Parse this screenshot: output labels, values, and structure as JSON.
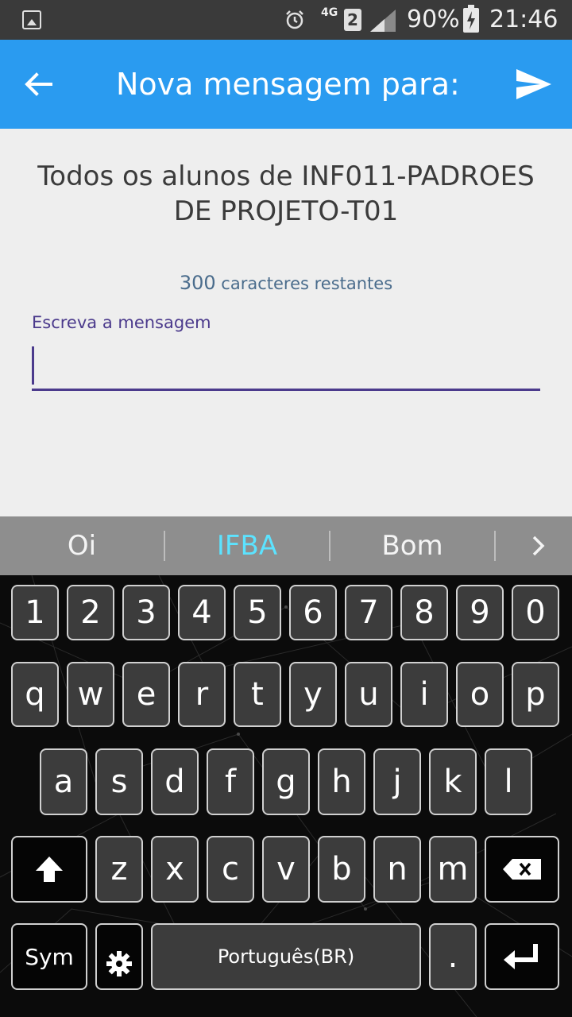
{
  "status_bar": {
    "battery_percent": "90%",
    "time": "21:46",
    "network_label": "4G",
    "sim_slot": "2",
    "icons": [
      "gallery-icon",
      "alarm-icon",
      "signal-icon",
      "battery-charging-icon"
    ]
  },
  "app_bar": {
    "title": "Nova mensagem para:",
    "back_icon": "arrow-left-icon",
    "send_icon": "send-icon",
    "color": "#2a9bf0"
  },
  "content": {
    "recipient": "Todos os alunos de INF011-PADROES DE PROJETO-T01",
    "chars_count": "300",
    "chars_suffix": " caracteres restantes",
    "message_label": "Escreva a mensagem",
    "message_value": ""
  },
  "suggestions": {
    "items": [
      "Oi",
      "IFBA",
      "Bom"
    ],
    "highlighted_index": 1,
    "more_icon": "chevron-right-icon"
  },
  "keyboard": {
    "row_numbers": [
      "1",
      "2",
      "3",
      "4",
      "5",
      "6",
      "7",
      "8",
      "9",
      "0"
    ],
    "row_top": [
      "q",
      "w",
      "e",
      "r",
      "t",
      "y",
      "u",
      "i",
      "o",
      "p"
    ],
    "row_home": [
      "a",
      "s",
      "d",
      "f",
      "g",
      "h",
      "j",
      "k",
      "l"
    ],
    "row_bottom": [
      "z",
      "x",
      "c",
      "v",
      "b",
      "n",
      "m"
    ],
    "sym_label": "Sym",
    "space_label": "Português(BR)",
    "period_label": ".",
    "shift_icon": "shift-icon",
    "backspace_icon": "backspace-icon",
    "settings_icon": "gear-icon",
    "enter_icon": "enter-icon"
  }
}
